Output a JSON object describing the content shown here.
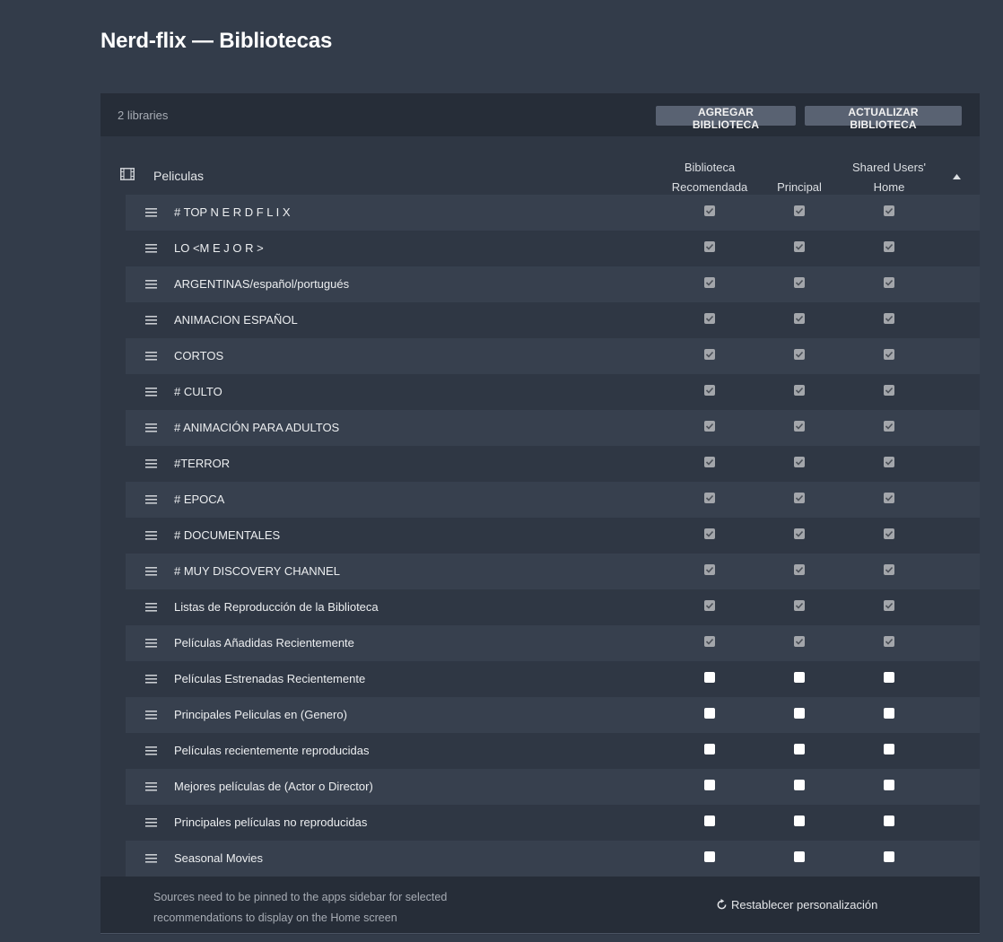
{
  "page": {
    "title": "Nerd-flix — Bibliotecas"
  },
  "toolbar": {
    "library_count": "2 libraries",
    "add_label": "AGREGAR BIBLIOTECA",
    "update_label": "ACTUALIZAR BIBLIOTECA"
  },
  "section": {
    "icon": "film-icon",
    "title": "Peliculas",
    "columns": [
      {
        "line1": "Biblioteca",
        "line2": "Recomendada"
      },
      {
        "line1": "Principal",
        "line2": ""
      },
      {
        "line1": "Shared Users'",
        "line2": "Home"
      }
    ],
    "sort_icon": "caret-up-icon"
  },
  "rows": [
    {
      "label": "# TOP N E R D F L I X",
      "recommended": true,
      "principal": true,
      "shared": true
    },
    {
      "label": "LO <M E J O R >",
      "recommended": true,
      "principal": true,
      "shared": true
    },
    {
      "label": "ARGENTINAS/español/portugués",
      "recommended": true,
      "principal": true,
      "shared": true
    },
    {
      "label": "ANIMACION ESPAÑOL",
      "recommended": true,
      "principal": true,
      "shared": true
    },
    {
      "label": "CORTOS",
      "recommended": true,
      "principal": true,
      "shared": true
    },
    {
      "label": "# CULTO",
      "recommended": true,
      "principal": true,
      "shared": true
    },
    {
      "label": "# ANIMACIÓN PARA ADULTOS",
      "recommended": true,
      "principal": true,
      "shared": true
    },
    {
      "label": "#TERROR",
      "recommended": true,
      "principal": true,
      "shared": true
    },
    {
      "label": "# EPOCA",
      "recommended": true,
      "principal": true,
      "shared": true
    },
    {
      "label": "# DOCUMENTALES",
      "recommended": true,
      "principal": true,
      "shared": true
    },
    {
      "label": "# MUY DISCOVERY CHANNEL",
      "recommended": true,
      "principal": true,
      "shared": true
    },
    {
      "label": "Listas de Reproducción de la Biblioteca",
      "recommended": true,
      "principal": true,
      "shared": true
    },
    {
      "label": "Películas Añadidas Recientemente",
      "recommended": true,
      "principal": true,
      "shared": true
    },
    {
      "label": "Películas Estrenadas Recientemente",
      "recommended": false,
      "principal": false,
      "shared": false
    },
    {
      "label": "Principales Peliculas en (Genero)",
      "recommended": false,
      "principal": false,
      "shared": false
    },
    {
      "label": "Películas recientemente reproducidas",
      "recommended": false,
      "principal": false,
      "shared": false
    },
    {
      "label": "Mejores películas de (Actor o Director)",
      "recommended": false,
      "principal": false,
      "shared": false
    },
    {
      "label": "Principales películas no reproducidas",
      "recommended": false,
      "principal": false,
      "shared": false
    },
    {
      "label": "Seasonal Movies",
      "recommended": false,
      "principal": false,
      "shared": false
    }
  ],
  "footer": {
    "note_line1": "Sources need to be pinned to the apps sidebar for selected",
    "note_line2": "recommendations to display on the Home screen",
    "reset_label": "Restablecer personalización",
    "reset_icon": "refresh-icon"
  },
  "colors": {
    "background": "#333c4a",
    "toolbar": "#262d38",
    "button": "#596272",
    "checkbox_checked": "#a3a6ab",
    "checkbox_unchecked": "#ffffff"
  }
}
